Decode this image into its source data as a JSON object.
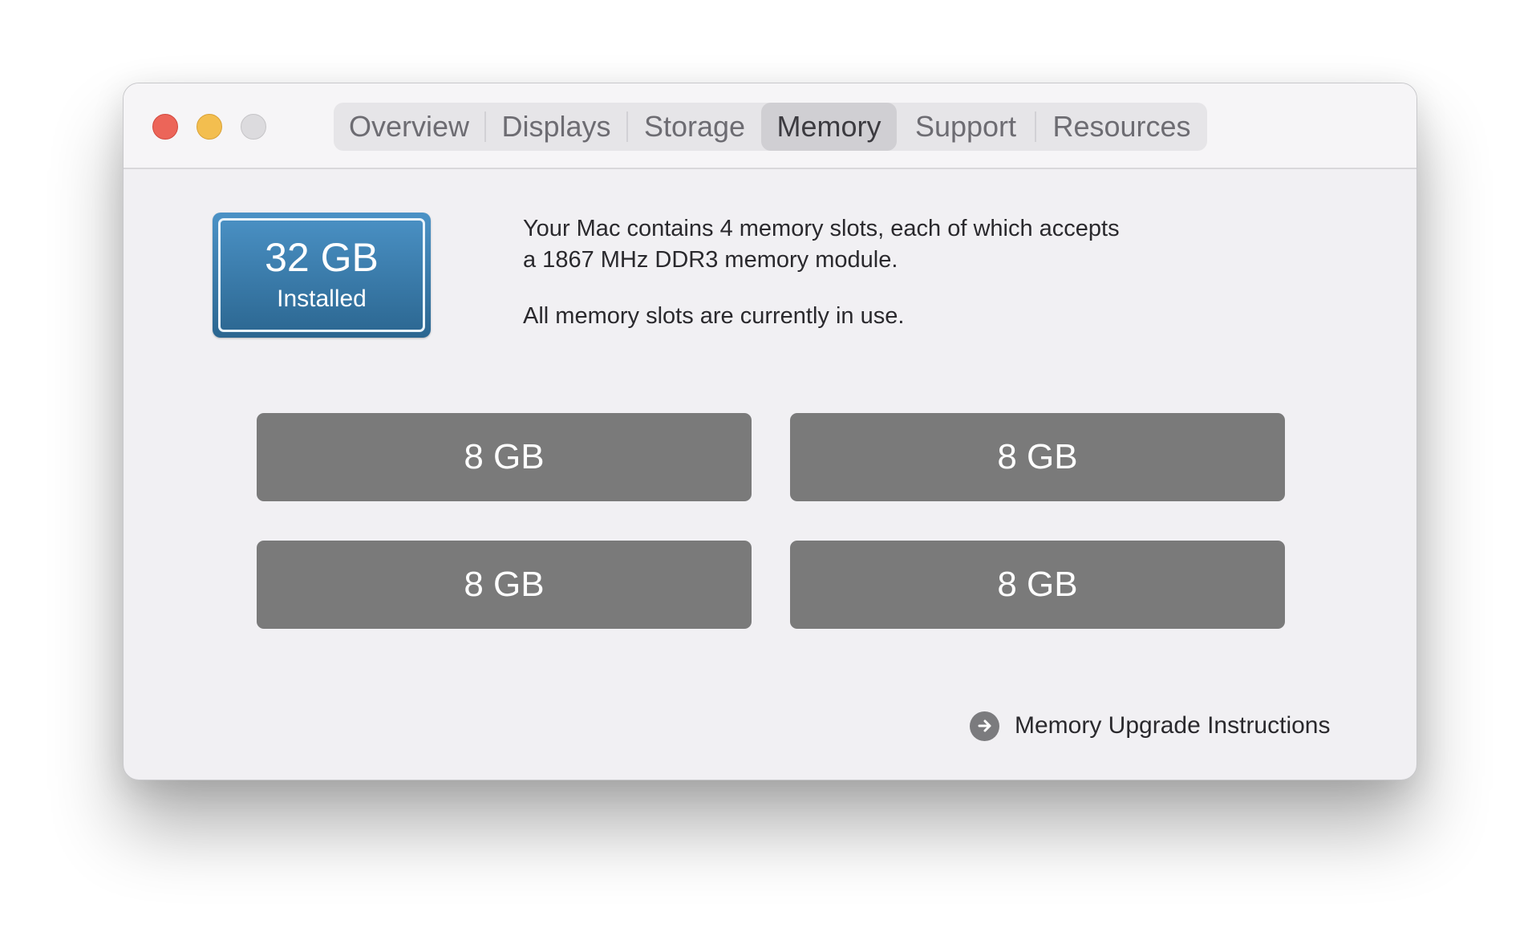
{
  "window": {
    "traffic_lights": [
      {
        "name": "close",
        "color": "#ec6559"
      },
      {
        "name": "minimize",
        "color": "#f3be4f"
      },
      {
        "name": "zoom",
        "color": "#dcdbde"
      }
    ]
  },
  "tabs": [
    {
      "label": "Overview",
      "selected": false
    },
    {
      "label": "Displays",
      "selected": false
    },
    {
      "label": "Storage",
      "selected": false
    },
    {
      "label": "Memory",
      "selected": true
    },
    {
      "label": "Support",
      "selected": false
    },
    {
      "label": "Resources",
      "selected": false
    }
  ],
  "memory": {
    "total": "32 GB",
    "total_label": "Installed",
    "badge_color": "#3b7cac",
    "description_line1": "Your Mac contains 4 memory slots, each of which accepts",
    "description_line2": "a 1867 MHz DDR3 memory module.",
    "status": "All memory slots are currently in use.",
    "slots": [
      {
        "size": "8 GB"
      },
      {
        "size": "8 GB"
      },
      {
        "size": "8 GB"
      },
      {
        "size": "8 GB"
      }
    ],
    "upgrade_link": "Memory Upgrade Instructions",
    "upgrade_icon": "arrow-right-circle-icon"
  }
}
